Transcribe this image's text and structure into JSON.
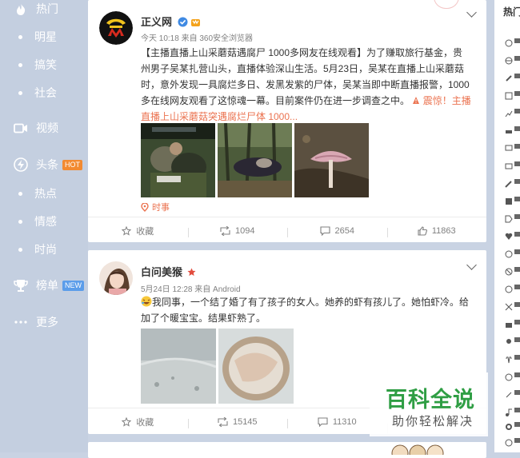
{
  "colors": {
    "sidebar_bg": "#c4cfe0",
    "page_bg": "#c9d3e3",
    "accent": "#eb7350",
    "verified": "#3f8ae3",
    "watermark": "#2f9e44"
  },
  "sidebar": {
    "items": [
      {
        "label": "热门",
        "icon": "flame-icon"
      },
      {
        "label": "明星",
        "icon": "dot"
      },
      {
        "label": "搞笑",
        "icon": "dot"
      },
      {
        "label": "社会",
        "icon": "dot"
      },
      {
        "label": "视频",
        "icon": "video-icon"
      },
      {
        "label": "头条",
        "icon": "lightning-icon",
        "badge": "HOT"
      },
      {
        "label": "热点",
        "icon": "dot"
      },
      {
        "label": "情感",
        "icon": "dot"
      },
      {
        "label": "时尚",
        "icon": "dot"
      },
      {
        "label": "榜单",
        "icon": "trophy-icon",
        "badge": "NEW"
      },
      {
        "label": "更多",
        "icon": "more-icon"
      }
    ]
  },
  "posts": [
    {
      "author": "正义网",
      "verified": true,
      "meta": "今天 10:18 来自 360安全浏览器",
      "text": "【主播直播上山采蘑菇遇腐尸 1000多网友在线观看】为了赚取旅行基金，贵州男子吴某扎营山头，直播体验深山生活。5月23日，吴某在直播上山采蘑菇时，意外发现一具腐烂多日、发黑发紫的尸体，吴某当即中断直播报警，1000多在线网友观看了这惊魂一幕。目前案件仍在进一步调查之中。",
      "link": "震惊！主播直播上山采蘑菇突遇腐烂尸体 1000...",
      "tag": "时事",
      "actions": {
        "favorite": "收藏",
        "repost": "1094",
        "comment": "2654",
        "like": "11863"
      }
    },
    {
      "author": "白问美猴",
      "meta": "5月24日 12:28 来自 Android",
      "text": "我同事，一个结了婚了有了孩子的女人。她养的虾有孩儿了。她怕虾冷。给加了个暖宝宝。结果虾熟了。",
      "actions": {
        "favorite": "收藏",
        "repost": "15145",
        "comment": "11310"
      }
    }
  ],
  "rightbar": {
    "title": "热门"
  },
  "watermark": {
    "title": "百科全说",
    "subtitle": "助你轻松解决"
  }
}
